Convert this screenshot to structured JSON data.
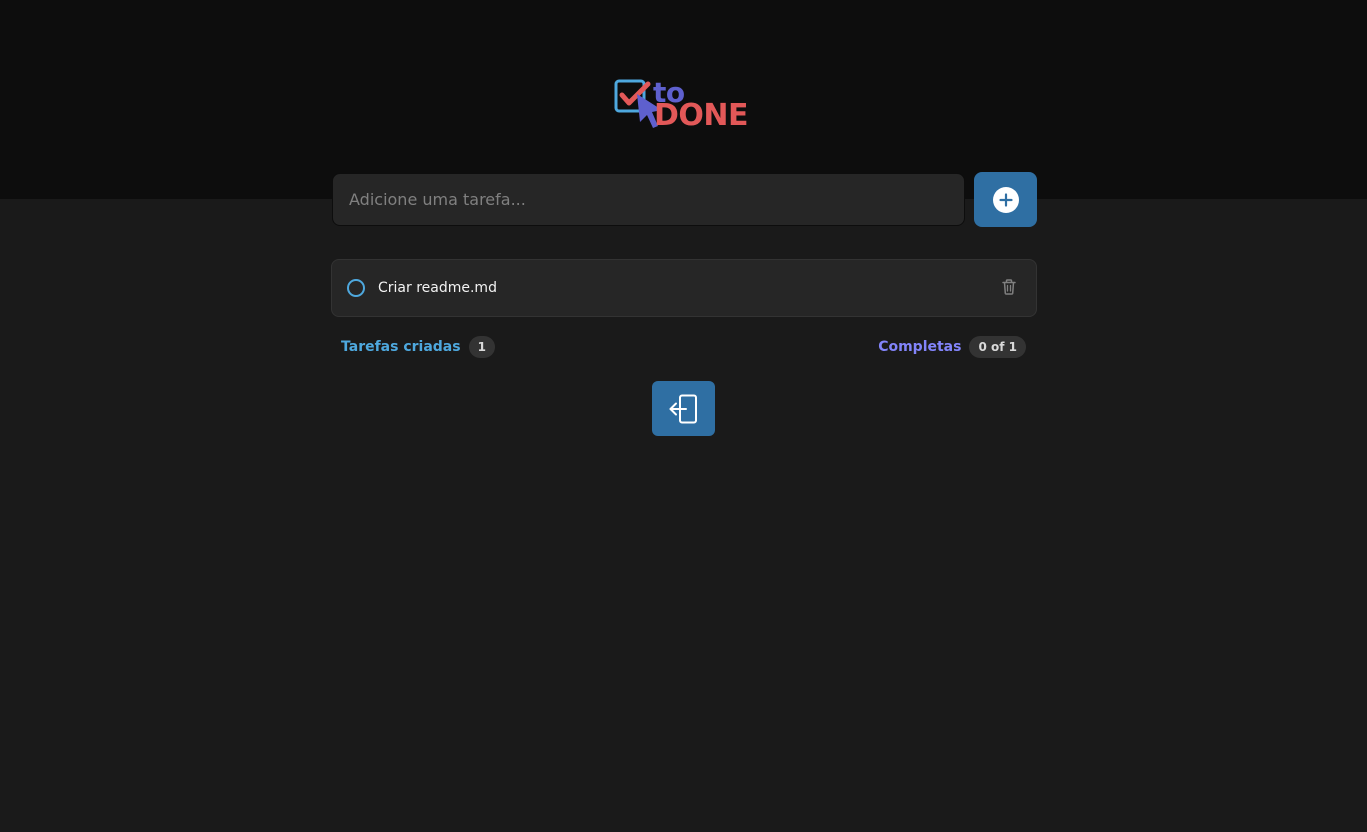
{
  "header": {
    "logo": {
      "word_to": "to",
      "word_done": "DONE"
    }
  },
  "new_task": {
    "placeholder": "Adicione uma tarefa...",
    "add_icon": "plus-circle-icon"
  },
  "tasks": [
    {
      "text": "Criar readme.md",
      "completed": false,
      "delete_icon": "trash-icon"
    }
  ],
  "stats": {
    "created_label": "Tarefas criadas",
    "created_count": "1",
    "done_label": "Completas",
    "done_count": "0 of 1"
  },
  "logout": {
    "icon": "logout-icon"
  },
  "colors": {
    "header_bg": "#0d0d0d",
    "page_bg": "#1a1a1a",
    "primary_button": "#2f6fa3",
    "blue": "#4ea8de",
    "purple": "#8284fa",
    "logo_purple": "#5e60ce",
    "logo_red": "#e25858"
  }
}
